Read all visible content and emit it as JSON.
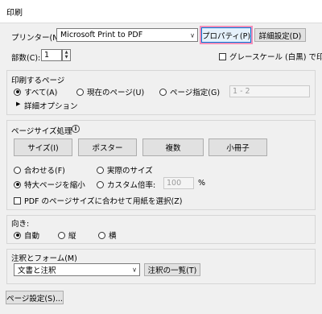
{
  "window": {
    "title": "印刷"
  },
  "printer": {
    "label": "プリンター(N):",
    "selected": "Microsoft Print to PDF",
    "properties_button": "プロパティ(P)",
    "advanced_button": "詳細設定(D)"
  },
  "copies": {
    "label": "部数(C):",
    "value": "1"
  },
  "grayscale": {
    "label": "グレースケール (白黒) で印刷"
  },
  "pages": {
    "heading": "印刷するページ",
    "all": "すべて(A)",
    "current": "現在のページ(U)",
    "specify": "ページ指定(G)",
    "range_placeholder": "1 - 2",
    "more_options": "詳細オプション"
  },
  "sizing": {
    "heading": "ページサイズ処理",
    "tabs": [
      "サイズ(I)",
      "ポスター",
      "複数",
      "小冊子"
    ],
    "fit": "合わせる(F)",
    "actual": "実際のサイズ",
    "shrink": "特大ページを縮小",
    "custom": "カスタム倍率:",
    "scale_value": "100",
    "percent": "%",
    "pdf_paper": "PDF のページサイズに合わせて用紙を選択(Z)"
  },
  "orientation": {
    "heading": "向き:",
    "auto": "自動",
    "portrait": "縦",
    "landscape": "横"
  },
  "comments": {
    "heading": "注釈とフォーム(M)",
    "selected": "文書と注釈",
    "summary_button": "注釈の一覧(T)"
  },
  "footer": {
    "page_setup_button": "ページ設定(S)..."
  }
}
